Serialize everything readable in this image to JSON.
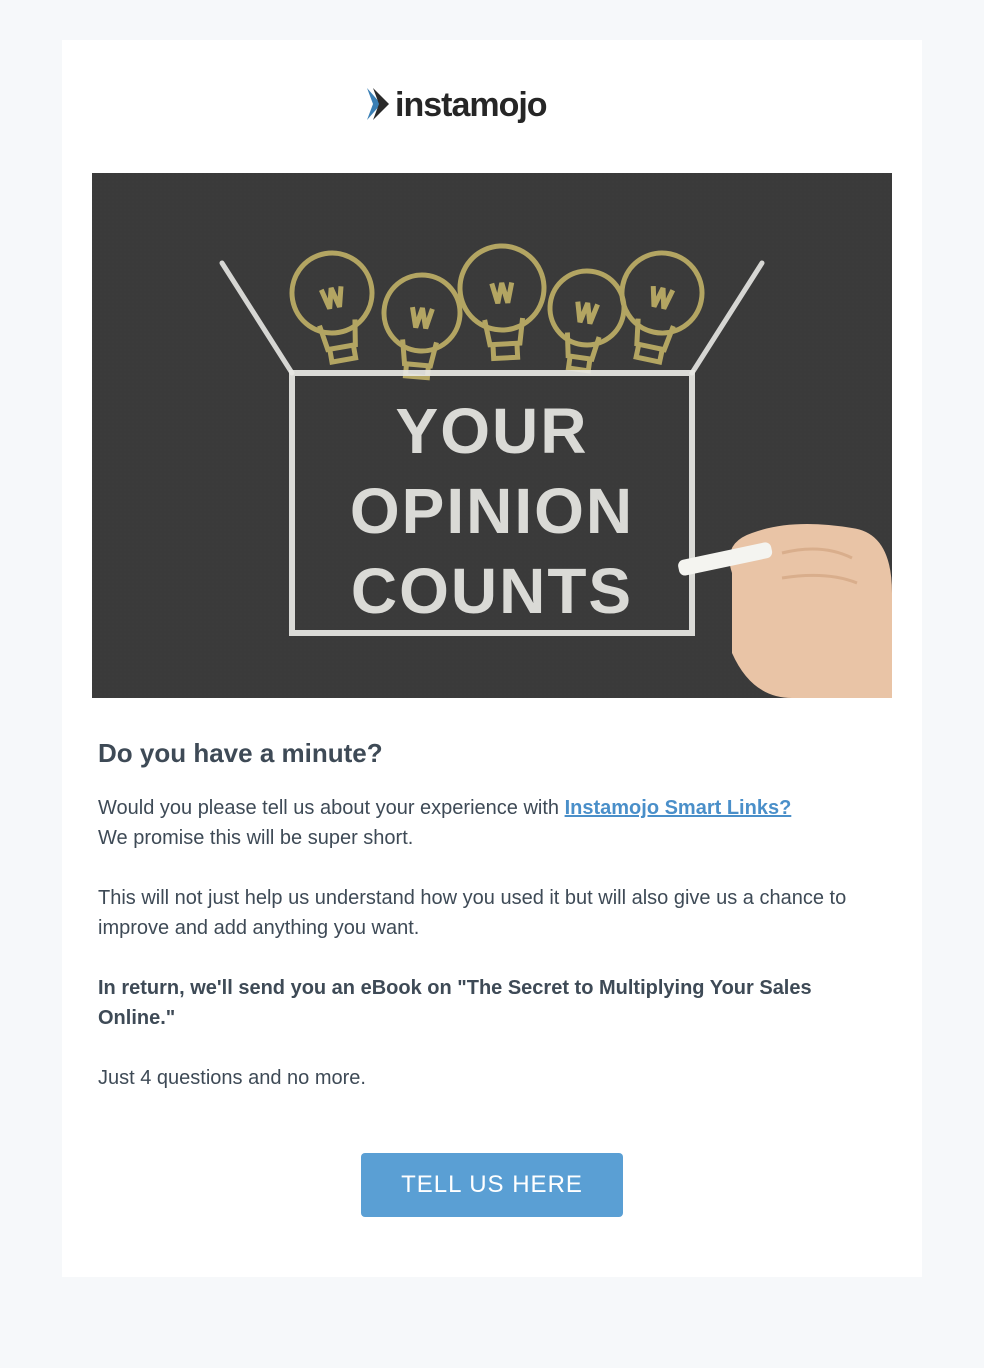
{
  "logo": {
    "brand_name": "instamojo"
  },
  "hero": {
    "line1": "YOUR",
    "line2": "OPINION",
    "line3": "COUNTS"
  },
  "heading": "Do you have a minute?",
  "para1_pre": "Would you please tell us about your experience with ",
  "para1_link": "Instamojo Smart Links?",
  "para1_post": "",
  "para1b": "We promise this will be super short.",
  "para2": "This will not just help us understand how you used it but will also give us a chance to improve and add anything you want.",
  "para3": "In return, we'll send you an eBook on \"The Secret to Multiplying Your Sales Online.\"",
  "para4": "Just 4 questions and no more.",
  "cta_label": "TELL US HERE"
}
